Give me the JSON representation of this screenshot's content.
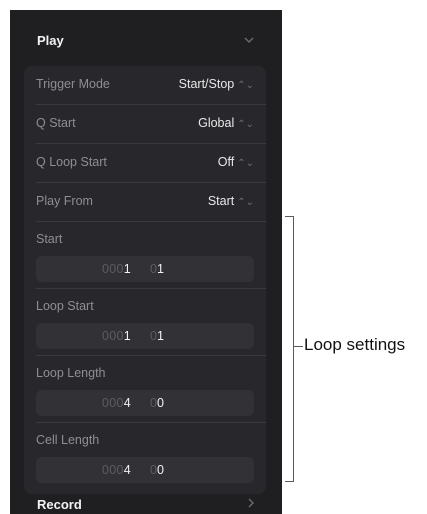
{
  "play": {
    "title": "Play",
    "rows": [
      {
        "label": "Trigger Mode",
        "value": "Start/Stop",
        "updown": "⌃⌄"
      },
      {
        "label": "Q Start",
        "value": "Global",
        "updown": "⌃⌄"
      },
      {
        "label": "Q Loop Start",
        "value": "Off",
        "updown": "⌃⌄"
      },
      {
        "label": "Play From",
        "value": "Start",
        "updown": "⌃⌄"
      }
    ],
    "fields": [
      {
        "label": "Start",
        "bar_dim": "000",
        "bar": "1",
        "beat_dim": "0",
        "beat": "1"
      },
      {
        "label": "Loop Start",
        "bar_dim": "000",
        "bar": "1",
        "beat_dim": "0",
        "beat": "1"
      },
      {
        "label": "Loop Length",
        "bar_dim": "000",
        "bar": "4",
        "beat_dim": "0",
        "beat": "0"
      },
      {
        "label": "Cell Length",
        "bar_dim": "000",
        "bar": "4",
        "beat_dim": "0",
        "beat": "0"
      }
    ]
  },
  "record": {
    "title": "Record"
  },
  "callout": {
    "label": "Loop settings"
  },
  "colors": {
    "panel": "#1f1f22",
    "group": "#28282c",
    "field": "#323236",
    "bracket": "#5a5a5a"
  },
  "icons": {
    "collapse": "chevron-down-icon",
    "expand": "chevron-right-icon"
  }
}
